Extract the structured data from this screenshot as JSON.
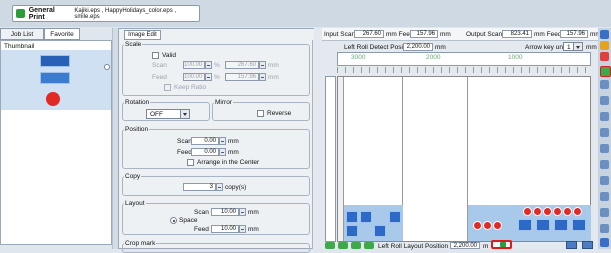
{
  "window": {
    "tab_label": "General Print",
    "tab_files": "Kajiki.eps , HappyHolidays_color.eps , smile.eps"
  },
  "left_tabs": [
    "Job List",
    "Favorite"
  ],
  "thumbnail": {
    "label": "Thumbnail"
  },
  "edit_tab": "Image Edit",
  "scale": {
    "group": "Scale",
    "valid_label": "Valid",
    "scan_label": "Scan",
    "scan_value": "100.00",
    "scan_unit": "%",
    "scan_mm": "267.60",
    "feed_label": "Feed",
    "feed_value": "100.00",
    "feed_unit": "%",
    "feed_mm": "157.96",
    "mm": "mm",
    "keep_ratio": "Keep Ratio"
  },
  "rotation": {
    "group": "Rotation",
    "value": "OFF"
  },
  "mirror": {
    "group": "Mirror",
    "reverse": "Reverse"
  },
  "position": {
    "group": "Position",
    "scan_label": "Scan",
    "scan_value": "0.00",
    "feed_label": "Feed",
    "feed_value": "0.00",
    "mm": "mm",
    "arrange_center": "Arrange in the Center"
  },
  "copy": {
    "group": "Copy",
    "value": "3",
    "unit": "copy(s)"
  },
  "layout": {
    "group": "Layout",
    "space_label": "Space",
    "scan_label": "Scan",
    "scan_value": "10.00",
    "feed_label": "Feed",
    "feed_value": "10.00",
    "mm": "mm"
  },
  "crop_mark": {
    "group": "Crop mark"
  },
  "info": {
    "input_scan_label": "Input Scan",
    "input_scan_value": "267.60",
    "mm_feed": "mm Feed",
    "input_feed_value": "157.96",
    "mm": "mm",
    "output_scan_label": "Output Scan",
    "output_scan_value": "823.41",
    "output_feed_value": "157.96"
  },
  "left_roll_detect": {
    "label": "Left Roll Detect Position",
    "value": "2,200.00",
    "unit": "mm"
  },
  "arrow_key": {
    "label": "Arrow key unit",
    "value": "1",
    "unit": "mm"
  },
  "ruler_ticks": [
    "3000",
    "2000",
    "1000"
  ],
  "left_roll_layout": {
    "label": "Left Roll Layout Position",
    "value": "2,200.00",
    "unit": "m"
  },
  "colors": {
    "accent": "#2c9d3b",
    "highlight_red": "#e01a1a",
    "panel": "#eef1f4"
  }
}
